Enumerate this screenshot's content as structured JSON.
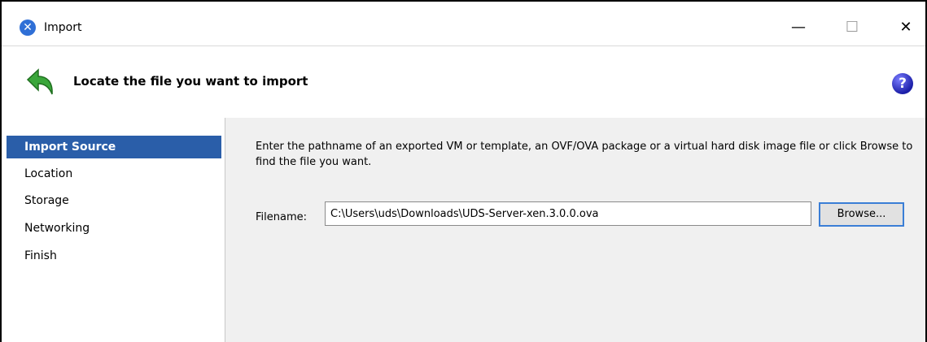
{
  "window": {
    "title": "Import",
    "icon": "xen-x-icon",
    "controls": {
      "minimize": "—",
      "maximize": "☐",
      "close": "✕"
    }
  },
  "banner": {
    "title": "Locate the file you want to import",
    "left_icon": "green-back-arrow-icon",
    "help_glyph": "?"
  },
  "sidebar": {
    "items": [
      {
        "label": "Import Source",
        "active": true
      },
      {
        "label": "Location"
      },
      {
        "label": "Storage"
      },
      {
        "label": "Networking"
      },
      {
        "label": "Finish"
      }
    ]
  },
  "main": {
    "instructions": "Enter the pathname of an exported VM or template, an OVF/OVA package or a virtual hard disk image file or click Browse to find the file you want.",
    "filename_label": "Filename:",
    "filename_value": "C:\\Users\\uds\\Downloads\\UDS-Server-xen.3.0.0.ova",
    "browse_label": "Browse..."
  },
  "colors": {
    "active_item": "#2a5ea9",
    "content_bg": "#f0f0f0",
    "focus_border": "#3a7ed6"
  }
}
